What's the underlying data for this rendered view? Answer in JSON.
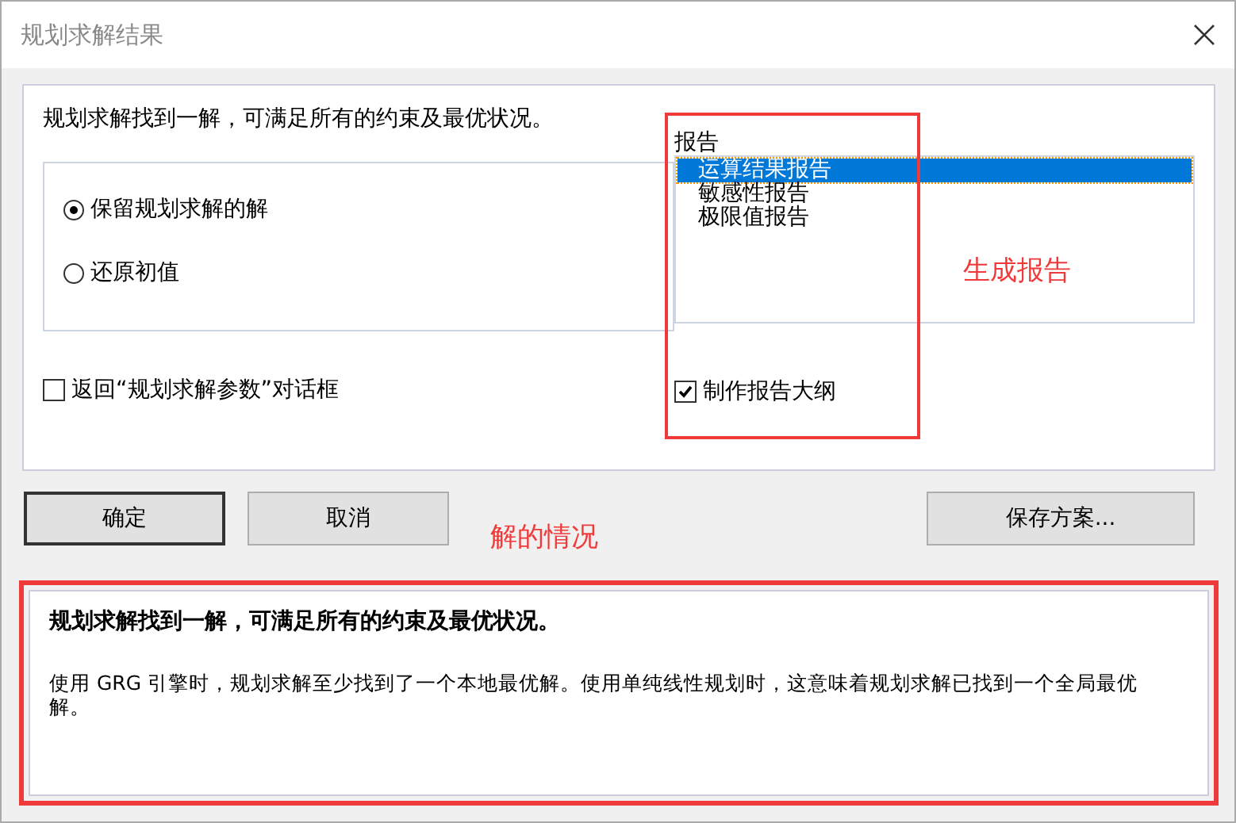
{
  "window": {
    "title": "规划求解结果"
  },
  "message": "规划求解找到一解，可满足所有的约束及最优状况。",
  "solution_options": [
    {
      "label": "保留规划求解的解",
      "selected": true
    },
    {
      "label": "还原初值",
      "selected": false
    }
  ],
  "return_dialog": {
    "label": "返回“规划求解参数”对话框",
    "checked": false
  },
  "reports": {
    "label": "报告",
    "items": [
      {
        "label": "运算结果报告",
        "selected": true
      },
      {
        "label": "敏感性报告",
        "selected": false
      },
      {
        "label": "极限值报告",
        "selected": false
      }
    ]
  },
  "outline": {
    "label": "制作报告大纲",
    "checked": true
  },
  "buttons": [
    {
      "label": "确定",
      "default": true
    },
    {
      "label": "取消",
      "default": false
    },
    {
      "label": "保存方案...",
      "default": false
    }
  ],
  "result": {
    "heading": "规划求解找到一解，可满足所有的约束及最优状况。",
    "detail": "使用 GRG 引擎时，规划求解至少找到了一个本地最优解。使用单纯线性规划时，这意味着规划求解已找到一个全局最优解。"
  },
  "annotations": [
    {
      "text": "生成报告"
    },
    {
      "text": "解的情况"
    }
  ]
}
